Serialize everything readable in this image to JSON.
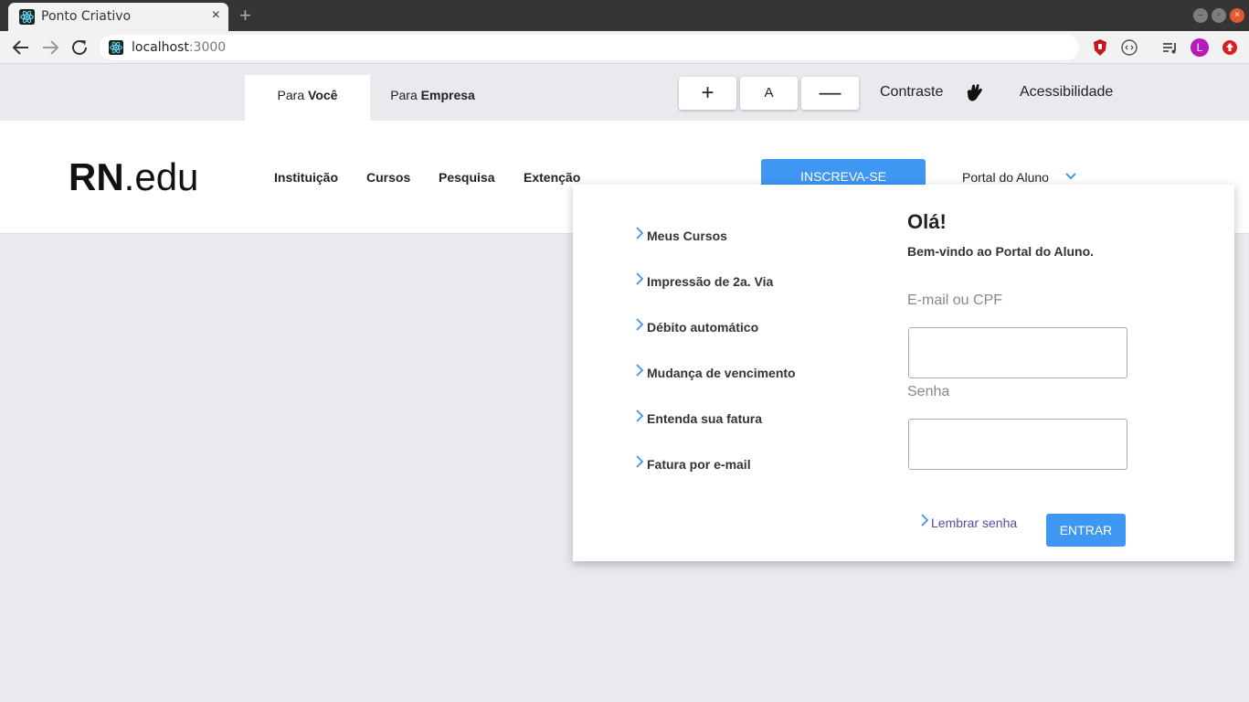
{
  "browser": {
    "tab_title": "Ponto Criativo",
    "tab_close": "×",
    "new_tab": "+",
    "url_host": "localhost",
    "url_port": ":3000",
    "profile_initial": "L"
  },
  "access_bar": {
    "tab_you_prefix": "Para ",
    "tab_you_bold": "Você",
    "tab_company_prefix": "Para ",
    "tab_company_bold": "Empresa",
    "font_increase": "+",
    "font_default": "A",
    "font_decrease": "—",
    "contrast": "Contraste",
    "accessibility": "Acessibilidade"
  },
  "header": {
    "logo_bold": "RN",
    "logo_rest": ".edu",
    "nav": [
      "Instituição",
      "Cursos",
      "Pesquisa",
      "Extenção"
    ],
    "cta": "INSCREVA-SE",
    "portal": "Portal do Aluno"
  },
  "dropdown": {
    "menu": [
      "Meus Cursos",
      "Impressão de 2a. Via",
      "Débito automático",
      "Mudança de vencimento",
      "Entenda sua fatura",
      "Fatura por e-mail"
    ],
    "hello": "Olá!",
    "welcome": "Bem-vindo ao Portal do Aluno.",
    "email_label": "E-mail ou CPF",
    "email_value": "",
    "password_label": "Senha",
    "password_value": "",
    "remember": "Lembrar senha",
    "enter": "ENTRAR"
  },
  "colors": {
    "accent": "#3d97f3",
    "link": "#5a47a8",
    "page_bg": "#e9eaee"
  }
}
